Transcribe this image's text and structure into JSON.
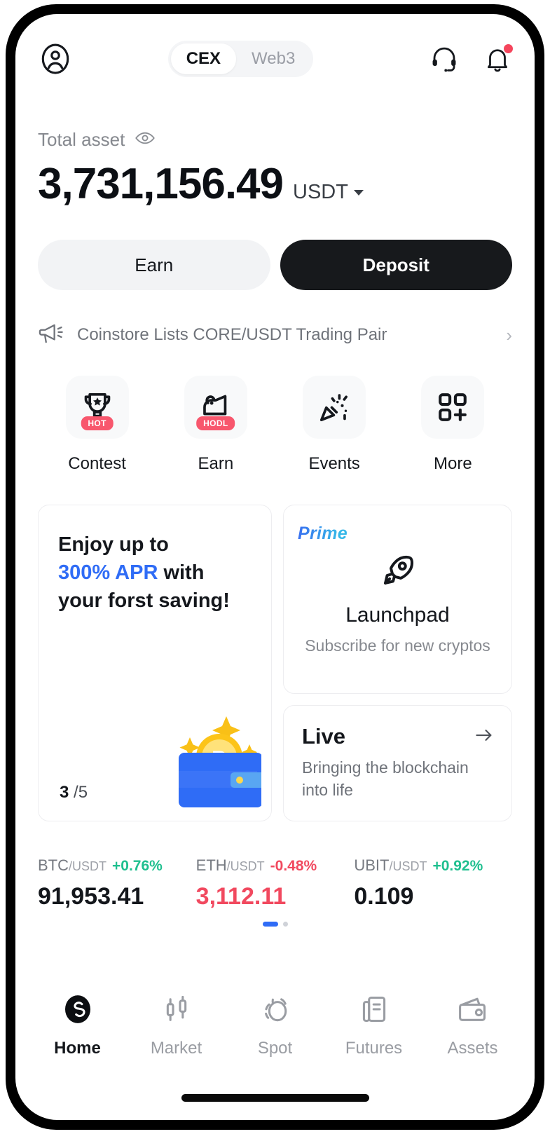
{
  "header": {
    "avatar_icon": "user-circle-icon",
    "tabs": [
      {
        "label": "CEX",
        "active": true
      },
      {
        "label": "Web3",
        "active": false
      }
    ],
    "support_icon": "headset-icon",
    "notification_icon": "bell-icon",
    "notification_badge": true
  },
  "balance": {
    "label": "Total asset",
    "eye_icon": "eye-icon",
    "amount": "3,731,156.49",
    "currency": "USDT",
    "currency_caret_icon": "chevron-down-icon"
  },
  "actions": {
    "earn_label": "Earn",
    "deposit_label": "Deposit"
  },
  "announcement": {
    "megaphone_icon": "megaphone-icon",
    "text": "Coinstore Lists CORE/USDT Trading Pair",
    "chevron": "›"
  },
  "quick_actions": [
    {
      "label": "Contest",
      "icon": "trophy-icon",
      "badge": "HOT"
    },
    {
      "label": "Earn",
      "icon": "piggy-hand-icon",
      "badge": "HODL"
    },
    {
      "label": "Events",
      "icon": "party-popper-icon",
      "badge": ""
    },
    {
      "label": "More",
      "icon": "grid-plus-icon",
      "badge": ""
    }
  ],
  "promo_card": {
    "line1": "Enjoy up to",
    "accent": "300% APR",
    "line2_tail": " with",
    "line3": "your forst saving!",
    "counter_current": "3",
    "counter_total": "/5",
    "art_icon": "wallet-bitcoin-illustration"
  },
  "prime_card": {
    "tag": "Prime",
    "icon": "rocket-icon",
    "title": "Launchpad",
    "subtitle": "Subscribe for new cryptos"
  },
  "live_card": {
    "title": "Live",
    "arrow_icon": "arrow-right-icon",
    "subtitle": "Bringing the blockchain into life"
  },
  "tickers": [
    {
      "base": "BTC",
      "quote": "/USDT",
      "change": "+0.76%",
      "direction": "up",
      "price": "91,953.41",
      "price_direction": "neutral"
    },
    {
      "base": "ETH",
      "quote": "/USDT",
      "change": "-0.48%",
      "direction": "down",
      "price": "3,112.11",
      "price_direction": "down"
    },
    {
      "base": "UBIT",
      "quote": "/USDT",
      "change": "+0.92%",
      "direction": "up",
      "price": "0.109",
      "price_direction": "neutral"
    }
  ],
  "carousel": {
    "page": 1,
    "total": 2
  },
  "bottom_nav": [
    {
      "label": "Home",
      "icon": "coinstore-logo-icon",
      "active": true
    },
    {
      "label": "Market",
      "icon": "candlestick-icon",
      "active": false
    },
    {
      "label": "Spot",
      "icon": "spot-swap-icon",
      "active": false
    },
    {
      "label": "Futures",
      "icon": "futures-doc-icon",
      "active": false
    },
    {
      "label": "Assets",
      "icon": "wallet-icon",
      "active": false
    }
  ],
  "colors": {
    "accent_blue": "#2f6cf6",
    "up_green": "#1fbf8f",
    "down_red": "#f1495f",
    "badge_red": "#f8576d",
    "dark": "#17191c"
  }
}
